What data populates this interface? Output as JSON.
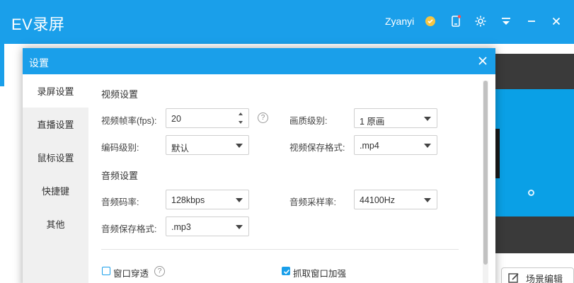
{
  "app": {
    "title": "EV录屏",
    "username": "Zyanyi",
    "header_icons": [
      "coin-icon",
      "phone-icon",
      "gear-icon",
      "menu-icon",
      "minimize-icon",
      "close-icon"
    ]
  },
  "scene_button": {
    "label": "场景编辑",
    "icon": "edit-icon"
  },
  "dialog": {
    "title": "设置",
    "nav": [
      {
        "label": "录屏设置",
        "active": true
      },
      {
        "label": "直播设置",
        "active": false
      },
      {
        "label": "鼠标设置",
        "active": false
      },
      {
        "label": "快捷键",
        "active": false
      },
      {
        "label": "其他",
        "active": false
      }
    ],
    "video_section": {
      "title": "视频设置",
      "fps_label": "视频帧率(fps):",
      "fps_value": "20",
      "quality_label": "画质级别:",
      "quality_value": "1 原画",
      "encoding_label": "编码级别:",
      "encoding_value": "默认",
      "video_format_label": "视频保存格式:",
      "video_format_value": ".mp4"
    },
    "audio_section": {
      "title": "音频设置",
      "bitrate_label": "音频码率:",
      "bitrate_value": "128kbps",
      "samplerate_label": "音频采样率:",
      "samplerate_value": "44100Hz",
      "audio_format_label": "音频保存格式:",
      "audio_format_value": ".mp3"
    },
    "options": {
      "window_through_label": "窗口穿透",
      "window_through_checked": false,
      "capture_boost_label": "抓取窗口加强",
      "capture_boost_checked": true
    },
    "help_glyph": "?"
  },
  "colors": {
    "accent": "#1a9fea",
    "nav_bg": "#f0f0f0",
    "preview_blue": "#0aa0e6"
  }
}
